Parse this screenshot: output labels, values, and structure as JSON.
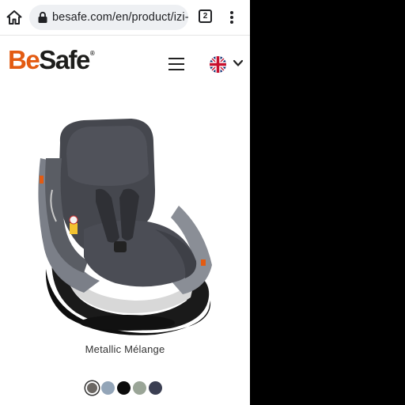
{
  "browser": {
    "url": "besafe.com/en/product/izi-m",
    "tab_count": "2",
    "icons": {
      "home": "home-icon",
      "lock": "lock-icon",
      "menu": "more-vert-icon"
    }
  },
  "header": {
    "logo_be": "Be",
    "logo_safe": "Safe",
    "logo_mark": "®",
    "language_flag": "uk-flag-icon",
    "colors": {
      "brand_orange": "#e35b12",
      "brand_dark": "#1d1d1b"
    }
  },
  "product": {
    "image": "car-seat-image",
    "selected_color_name": "Metallic Mélange",
    "swatches": [
      {
        "name": "metallic-melange",
        "color": "#6b6763",
        "selected": true
      },
      {
        "name": "light-blue-grey",
        "color": "#93a5b8",
        "selected": false
      },
      {
        "name": "black",
        "color": "#0b0b0b",
        "selected": false
      },
      {
        "name": "sage-grey",
        "color": "#9aa597",
        "selected": false
      },
      {
        "name": "navy-grey",
        "color": "#3b3f52",
        "selected": false
      }
    ]
  }
}
